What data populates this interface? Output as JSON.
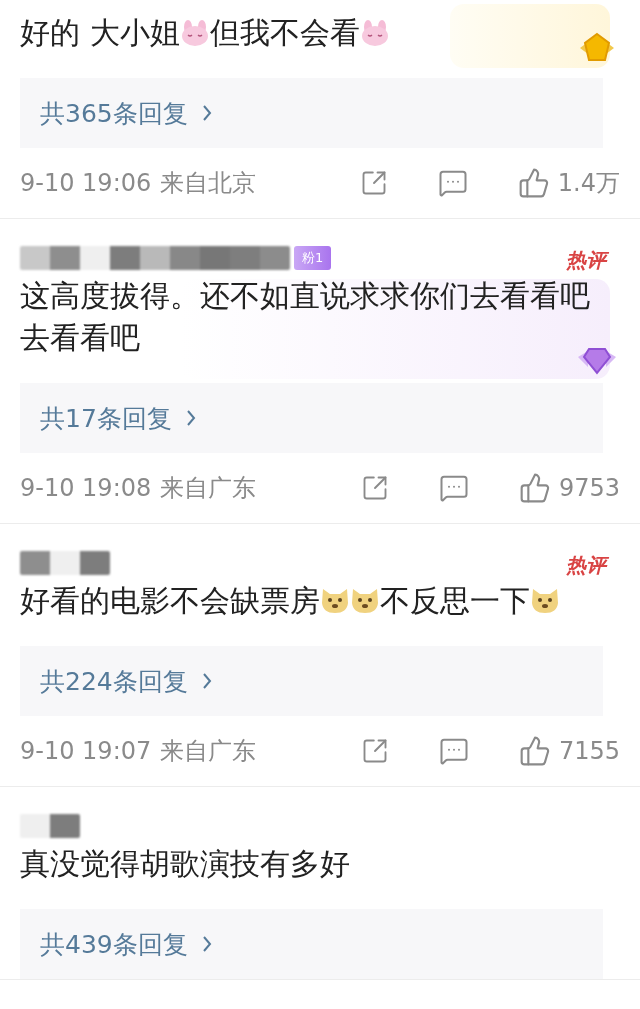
{
  "comments": [
    {
      "decor": {
        "kind": "medal"
      },
      "content": [
        {
          "kind": "text",
          "text": "好的 大小姐"
        },
        {
          "kind": "bunny"
        },
        {
          "kind": "text",
          "text": "但我不会看"
        },
        {
          "kind": "bunny"
        }
      ],
      "replies": "共365条回复",
      "time": "9-10 19:06",
      "location": "来自北京",
      "likes": "1.4万"
    },
    {
      "fan_badge": "粉1",
      "hot_tag": "热评",
      "decor": {
        "kind": "diamond"
      },
      "content": [
        {
          "kind": "text",
          "text": "这高度拔得。还不如直说求求你们去看看吧去看看吧"
        }
      ],
      "replies": "共17条回复",
      "time": "9-10 19:08",
      "location": "来自广东",
      "likes": "9753"
    },
    {
      "hot_tag": "热评",
      "content": [
        {
          "kind": "text",
          "text": "好看的电影不会缺票房"
        },
        {
          "kind": "doge"
        },
        {
          "kind": "doge"
        },
        {
          "kind": "text",
          "text": "不反思一下"
        },
        {
          "kind": "doge"
        }
      ],
      "replies": "共224条回复",
      "time": "9-10 19:07",
      "location": "来自广东",
      "likes": "7155"
    },
    {
      "content": [
        {
          "kind": "text",
          "text": "真没觉得胡歌演技有多好"
        }
      ],
      "replies": "共439条回复"
    }
  ]
}
